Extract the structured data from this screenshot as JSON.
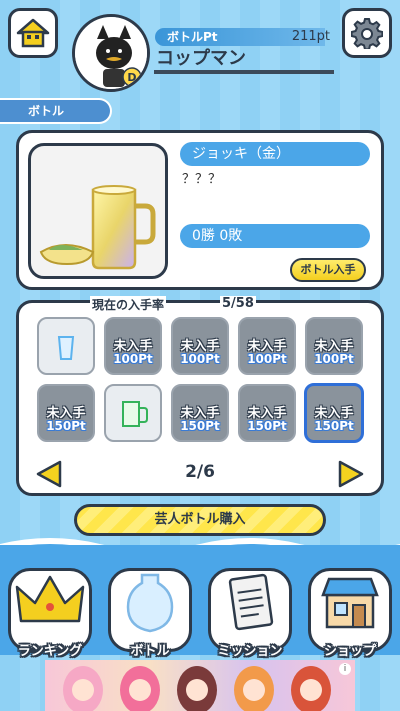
{
  "header": {
    "pt_label": "ボトルPt",
    "pt_value": "211pt",
    "user_name": "コップマン"
  },
  "section": {
    "label": "ボトル"
  },
  "detail": {
    "name": "ジョッキ（金）",
    "description": "？？？",
    "record": "0勝 0敗",
    "get_button": "ボトル入手"
  },
  "collection": {
    "rate_label": "現在の入手率",
    "rate_value": "5/58",
    "page": "2/6",
    "cells": [
      {
        "state": "owned",
        "label": "",
        "price": ""
      },
      {
        "state": "locked",
        "label": "未入手",
        "price": "100Pt"
      },
      {
        "state": "locked",
        "label": "未入手",
        "price": "100Pt"
      },
      {
        "state": "locked",
        "label": "未入手",
        "price": "100Pt"
      },
      {
        "state": "locked",
        "label": "未入手",
        "price": "100Pt"
      },
      {
        "state": "locked",
        "label": "未入手",
        "price": "150Pt"
      },
      {
        "state": "owned",
        "label": "",
        "price": ""
      },
      {
        "state": "locked",
        "label": "未入手",
        "price": "150Pt"
      },
      {
        "state": "locked",
        "label": "未入手",
        "price": "150Pt"
      },
      {
        "state": "locked-selected",
        "label": "未入手",
        "price": "150Pt"
      }
    ]
  },
  "buy_button": "芸人ボトル購入",
  "nav": [
    {
      "label": "ランキング",
      "icon": "crown-icon"
    },
    {
      "label": "ボトル",
      "icon": "vase-icon"
    },
    {
      "label": "ミッション",
      "icon": "clipboard-icon"
    },
    {
      "label": "ショップ",
      "icon": "shop-icon"
    }
  ],
  "colors": {
    "accent_blue": "#4ba6e8",
    "dark_outline": "#2d3a4a",
    "yellow": "#f4cf1f"
  }
}
